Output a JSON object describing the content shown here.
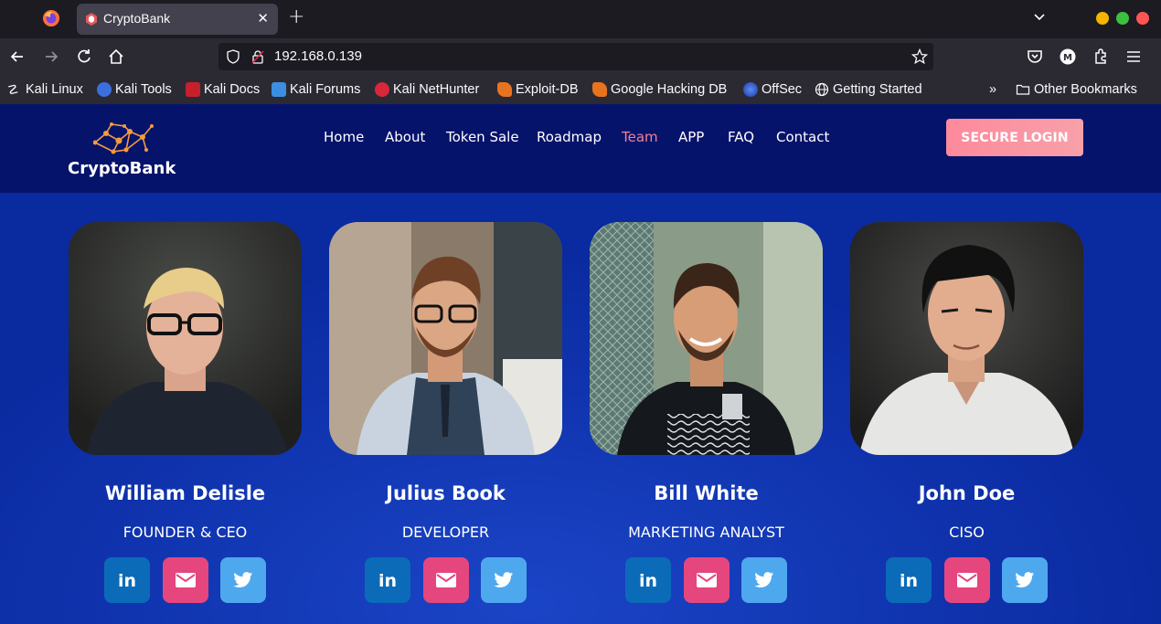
{
  "browser": {
    "tab_title": "CryptoBank",
    "url": "192.168.0.139",
    "bookmarks": [
      {
        "label": "Kali Linux",
        "icon": "kali-dragon-icon"
      },
      {
        "label": "Kali Tools",
        "icon": "kali-tools-icon"
      },
      {
        "label": "Kali Docs",
        "icon": "kali-docs-icon"
      },
      {
        "label": "Kali Forums",
        "icon": "kali-forums-icon"
      },
      {
        "label": "Kali NetHunter",
        "icon": "kali-nethunter-icon"
      },
      {
        "label": "Exploit-DB",
        "icon": "exploit-db-icon"
      },
      {
        "label": "Google Hacking DB",
        "icon": "ghdb-icon"
      },
      {
        "label": "OffSec",
        "icon": "offsec-icon"
      },
      {
        "label": "Getting Started",
        "icon": "globe-icon"
      }
    ],
    "other_bookmarks": "Other Bookmarks",
    "window_dot_colors": [
      "#f4b400",
      "#3fbf3f",
      "#ff5555"
    ]
  },
  "site": {
    "brand": "CryptoBank",
    "nav": [
      "Home",
      "About",
      "Token Sale",
      "Roadmap",
      "Team",
      "APP",
      "FAQ",
      "Contact"
    ],
    "active_nav": "Team",
    "login_label": "SECURE LOGIN",
    "accent_color": "#f5808f",
    "background_color": "#0a2aa0"
  },
  "team": [
    {
      "name": "William Delisle",
      "role": "FOUNDER & CEO"
    },
    {
      "name": "Julius Book",
      "role": "DEVELOPER"
    },
    {
      "name": "Bill White",
      "role": "MARKETING ANALYST"
    },
    {
      "name": "John Doe",
      "role": "CISO"
    }
  ],
  "social_icons": [
    "linkedin-icon",
    "email-icon",
    "twitter-icon"
  ]
}
